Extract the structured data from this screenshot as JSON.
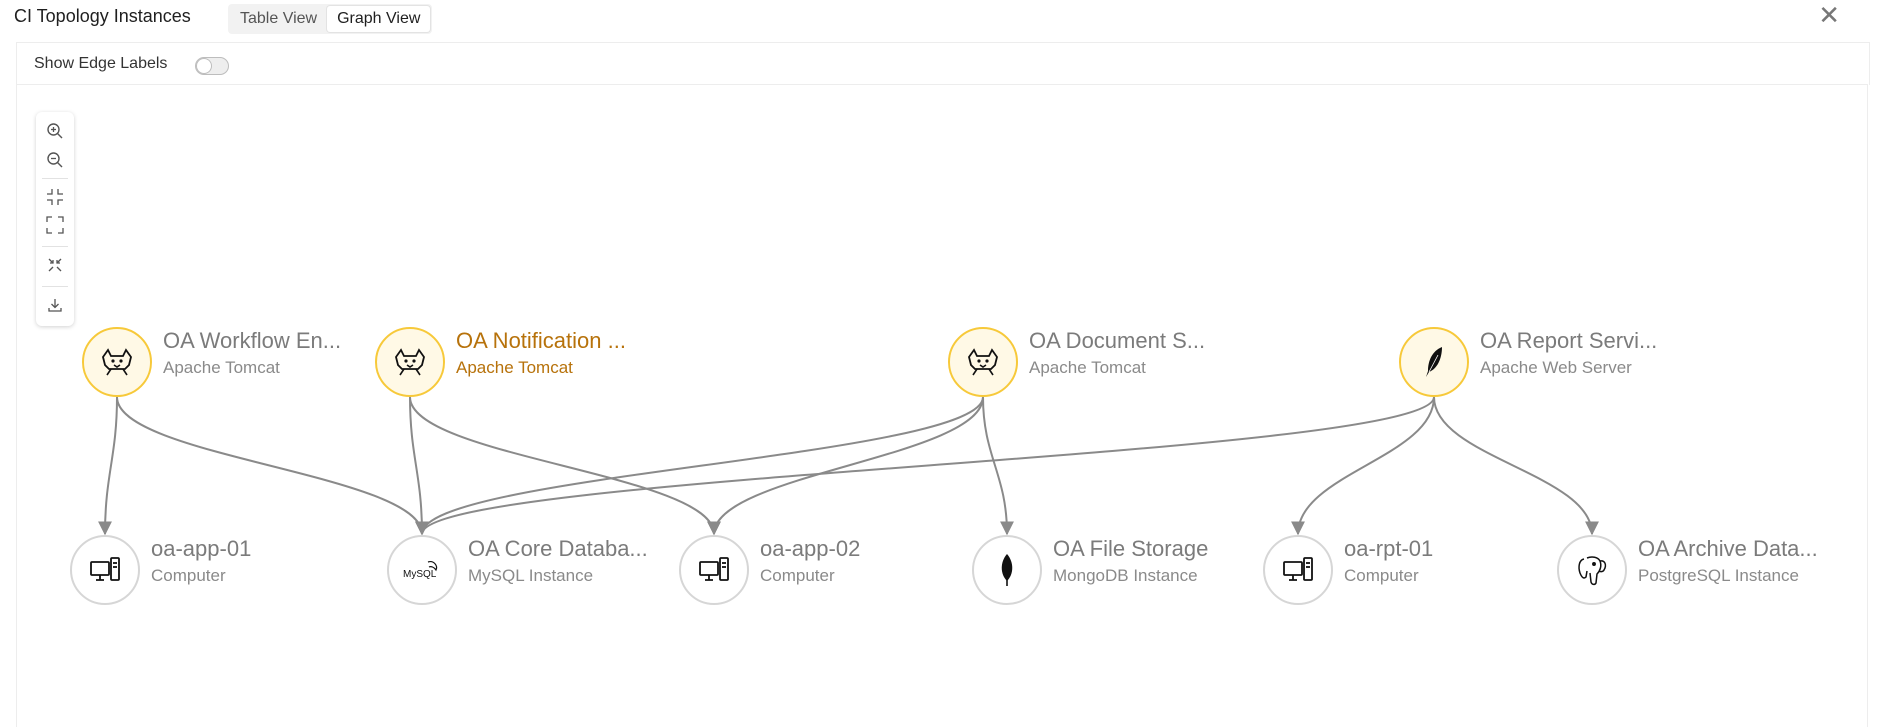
{
  "header": {
    "title": "CI Topology Instances",
    "tabs": [
      {
        "label": "Table View",
        "active": false
      },
      {
        "label": "Graph View",
        "active": true
      }
    ]
  },
  "toolbar": {
    "show_edge_labels": "Show Edge Labels",
    "toggle_on": false
  },
  "zoom_controls": [
    "zoom-in",
    "zoom-out",
    "fit-view",
    "fullscreen",
    "auto-layout",
    "download"
  ],
  "colors": {
    "tomcat_fill": "#fff9e6",
    "tomcat_border": "#f7c93a",
    "highlight_text": "#b7720b",
    "edge": "#8a8a8a",
    "node_border": "#d6d6d6"
  },
  "nodes": [
    {
      "id": "wf",
      "name": "OA Workflow En...",
      "type": "Apache Tomcat",
      "icon": "tomcat-icon",
      "row": 1,
      "highlight": false
    },
    {
      "id": "notif",
      "name": "OA Notification ...",
      "type": "Apache Tomcat",
      "icon": "tomcat-icon",
      "row": 1,
      "highlight": true
    },
    {
      "id": "doc",
      "name": "OA Document S...",
      "type": "Apache Tomcat",
      "icon": "tomcat-icon",
      "row": 1,
      "highlight": false
    },
    {
      "id": "rep",
      "name": "OA Report Servi...",
      "type": "Apache Web Server",
      "icon": "apache-feather-icon",
      "row": 1,
      "highlight": false
    },
    {
      "id": "app01",
      "name": "oa-app-01",
      "type": "Computer",
      "icon": "computer-icon",
      "row": 2,
      "highlight": false
    },
    {
      "id": "coredb",
      "name": "OA Core Databa...",
      "type": "MySQL Instance",
      "icon": "mysql-icon",
      "row": 2,
      "highlight": false
    },
    {
      "id": "app02",
      "name": "oa-app-02",
      "type": "Computer",
      "icon": "computer-icon",
      "row": 2,
      "highlight": false
    },
    {
      "id": "files",
      "name": "OA File Storage",
      "type": "MongoDB Instance",
      "icon": "mongodb-leaf-icon",
      "row": 2,
      "highlight": false
    },
    {
      "id": "rpt01",
      "name": "oa-rpt-01",
      "type": "Computer",
      "icon": "computer-icon",
      "row": 2,
      "highlight": false
    },
    {
      "id": "archive",
      "name": "OA Archive Data...",
      "type": "PostgreSQL Instance",
      "icon": "postgresql-icon",
      "row": 2,
      "highlight": false
    }
  ],
  "edges": [
    {
      "from": "wf",
      "to": "app01"
    },
    {
      "from": "wf",
      "to": "coredb"
    },
    {
      "from": "notif",
      "to": "coredb"
    },
    {
      "from": "notif",
      "to": "app02"
    },
    {
      "from": "doc",
      "to": "coredb"
    },
    {
      "from": "doc",
      "to": "app02"
    },
    {
      "from": "doc",
      "to": "files"
    },
    {
      "from": "rep",
      "to": "coredb"
    },
    {
      "from": "rep",
      "to": "rpt01"
    },
    {
      "from": "rep",
      "to": "archive"
    }
  ]
}
